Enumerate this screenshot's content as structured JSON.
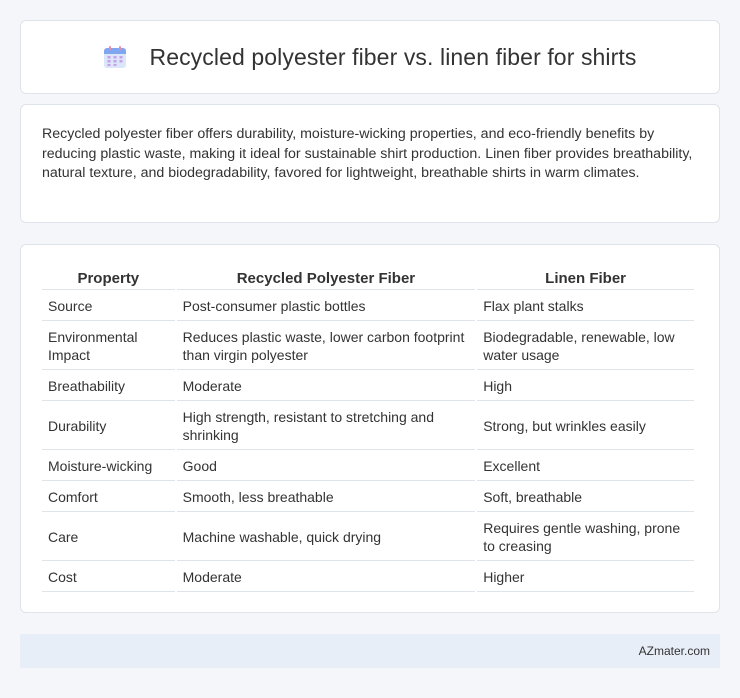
{
  "header": {
    "title": "Recycled polyester fiber vs. linen fiber for shirts",
    "icon": "calendar-icon"
  },
  "summary": {
    "text": "Recycled polyester fiber offers durability, moisture-wicking properties, and eco-friendly benefits by reducing plastic waste, making it ideal for sustainable shirt production. Linen fiber provides breathability, natural texture, and biodegradability, favored for lightweight, breathable shirts in warm climates."
  },
  "table": {
    "headers": [
      "Property",
      "Recycled Polyester Fiber",
      "Linen Fiber"
    ],
    "rows": [
      [
        "Source",
        "Post-consumer plastic bottles",
        "Flax plant stalks"
      ],
      [
        "Environmental Impact",
        "Reduces plastic waste, lower carbon footprint than virgin polyester",
        "Biodegradable, renewable, low water usage"
      ],
      [
        "Breathability",
        "Moderate",
        "High"
      ],
      [
        "Durability",
        "High strength, resistant to stretching and shrinking",
        "Strong, but wrinkles easily"
      ],
      [
        "Moisture-wicking",
        "Good",
        "Excellent"
      ],
      [
        "Comfort",
        "Smooth, less breathable",
        "Soft, breathable"
      ],
      [
        "Care",
        "Machine washable, quick drying",
        "Requires gentle washing, prone to creasing"
      ],
      [
        "Cost",
        "Moderate",
        "Higher"
      ]
    ]
  },
  "footer": {
    "text": "AZmater.com"
  }
}
